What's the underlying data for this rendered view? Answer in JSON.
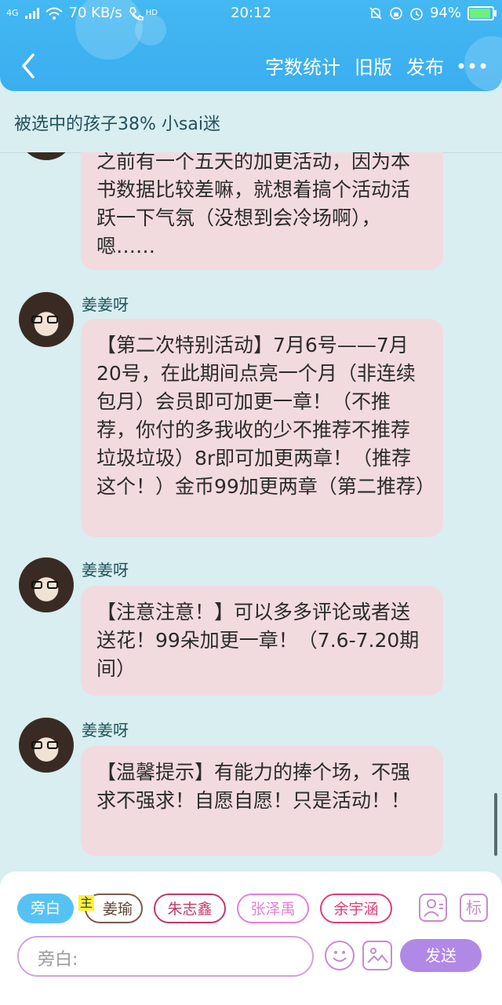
{
  "status_bar": {
    "network": "4G",
    "speed": "70 KB/s",
    "call_badge": "HD",
    "time": "20:12",
    "battery": "94%",
    "battery_level": 0.94
  },
  "nav": {
    "actions": [
      "字数统计",
      "旧版",
      "发布"
    ]
  },
  "book_title": "被选中的孩子38% 小sai迷",
  "messages": [
    {
      "sender": "",
      "text": "之前有一个五天的加更活动，因为本书数据比较差嘛，就想着搞个活动活跃一下气氛（没想到会冷场啊），嗯……"
    },
    {
      "sender": "姜姜呀",
      "text": "【第二次特别活动】7月6号——7月20号，在此期间点亮一个月（非连续包月）会员即可加更一章！（不推荐，你付的多我收的少不推荐不推荐垃圾垃圾）8r即可加更两章！（推荐这个！）金币99加更两章（第二推荐）"
    },
    {
      "sender": "姜姜呀",
      "text": "【注意注意！】可以多多评论或者送送花！99朵加更一章！（7.6-7.20期间）"
    },
    {
      "sender": "姜姜呀",
      "text": "【温馨提示】有能力的捧个场，不强求不强求！自愿自愿！只是活动！！"
    }
  ],
  "composer": {
    "narrator_chip": "旁白",
    "main_badge": "主",
    "characters": [
      "姜瑜",
      "朱志鑫",
      "张泽禹",
      "余宇涵"
    ],
    "mark_button": "标",
    "input_placeholder": "旁白:",
    "send_label": "发送"
  }
}
